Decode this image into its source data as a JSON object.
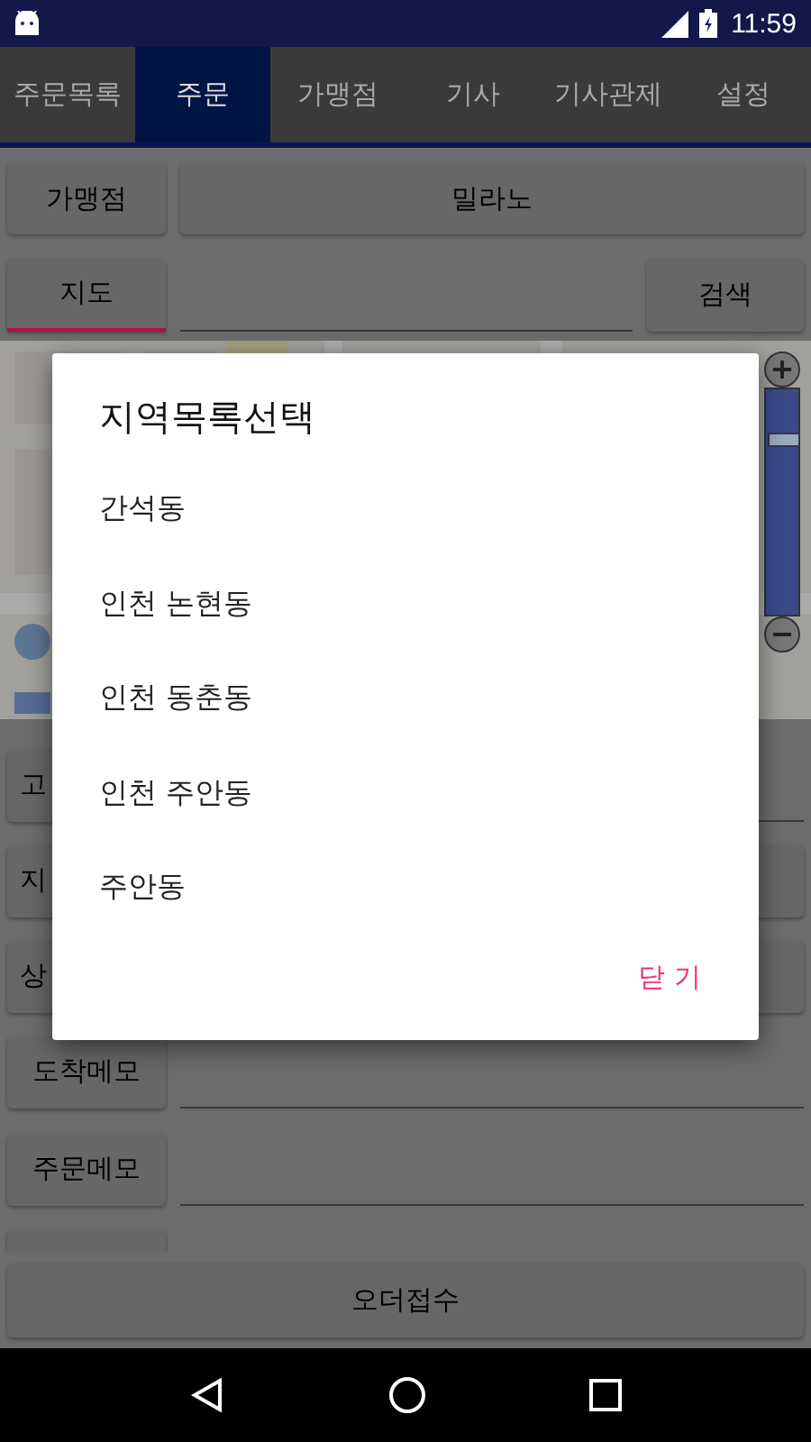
{
  "status_bar": {
    "time": "11:59"
  },
  "tabs": [
    {
      "label": "주문목록",
      "selected": false
    },
    {
      "label": "주문",
      "selected": true
    },
    {
      "label": "가맹점",
      "selected": false
    },
    {
      "label": "기사",
      "selected": false
    },
    {
      "label": "기사관제",
      "selected": false
    },
    {
      "label": "설정",
      "selected": false
    }
  ],
  "store_row": {
    "label": "가맹점",
    "value": "밀라노"
  },
  "map_row": {
    "label": "지도",
    "button": "검색"
  },
  "map": {
    "kind": "picture",
    "zoom": {
      "level": 0.8
    }
  },
  "form_rows": [
    {
      "label": "고",
      "kind": "field"
    },
    {
      "label": "지",
      "kind": "button"
    },
    {
      "label": "상",
      "kind": "button"
    },
    {
      "label": "도착메모",
      "kind": "field"
    },
    {
      "label": "주문메모",
      "kind": "field"
    },
    {
      "kind": "stub"
    }
  ],
  "submit_button": "오더접수",
  "dialog": {
    "title": "지역목록선택",
    "items": [
      "간석동",
      "인천 논현동",
      "인천 동춘동",
      "인천 주안동",
      "주안동"
    ],
    "close": "닫 기"
  }
}
